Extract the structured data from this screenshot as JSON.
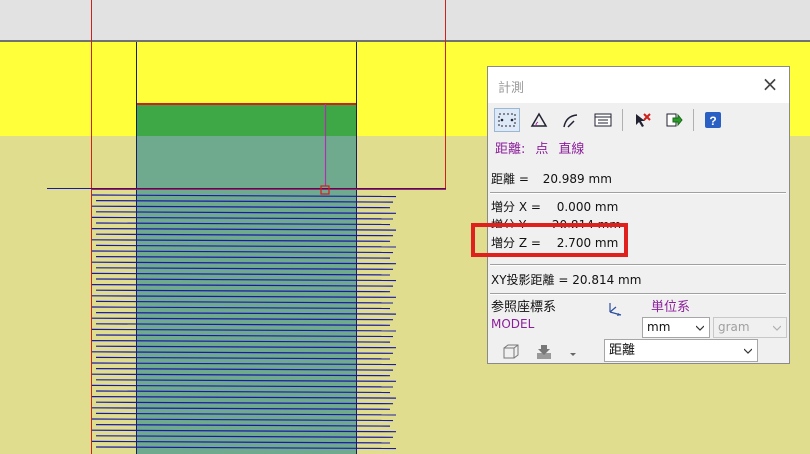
{
  "dialog": {
    "title": "計測",
    "mode_label": "距離:",
    "mode_from": "点",
    "mode_to": "直線",
    "distance_label": "距離 =",
    "distance_value": "20.989 mm",
    "dx_label": "増分 X =",
    "dx_value": "0.000 mm",
    "dy_label": "増分 Y =",
    "dy_value": "20.814 mm",
    "dz_label": "増分 Z =",
    "dz_value": "2.700 mm",
    "xy_label": "XY投影距離 =",
    "xy_value": "20.814 mm",
    "ref_label": "参照座標系",
    "ref_value": "MODEL",
    "units_label": "単位系",
    "length_unit": "mm",
    "mass_unit": "gram",
    "measure_type": "距離"
  },
  "colors": {
    "yellow": "#ffff3a",
    "pale_yellow": "#e1dd8f",
    "green": "#3ea746",
    "teal": "#6faa8f",
    "blue_line": "#1a1aa6",
    "red_line": "#d0201c",
    "highlight": "#e0201c"
  },
  "icons": [
    "point-to-point-icon",
    "angle-icon",
    "arc-icon",
    "list-icon",
    "clear-selection-icon",
    "export-icon",
    "help-icon",
    "box-icon",
    "save-icon",
    "dropdown-arrow-icon",
    "axis-icon"
  ]
}
